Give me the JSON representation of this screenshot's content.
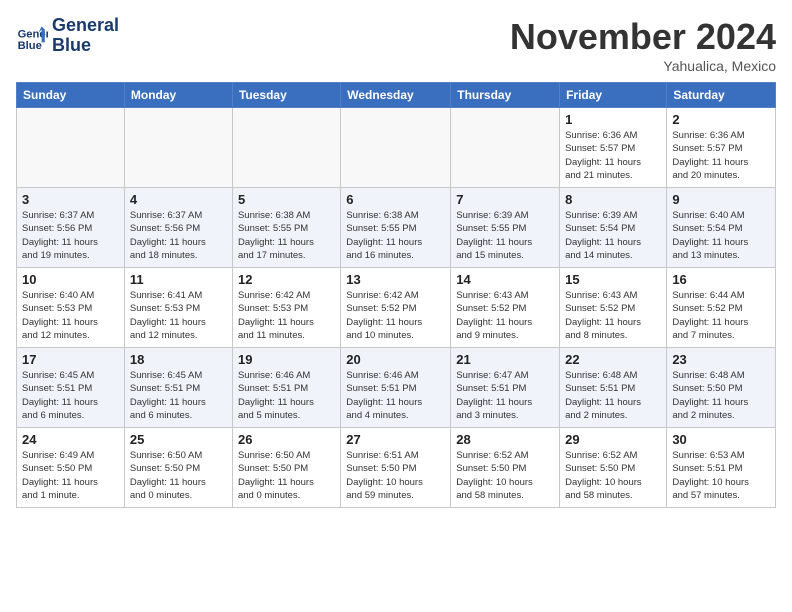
{
  "header": {
    "logo_line1": "General",
    "logo_line2": "Blue",
    "month": "November 2024",
    "location": "Yahualica, Mexico"
  },
  "weekdays": [
    "Sunday",
    "Monday",
    "Tuesday",
    "Wednesday",
    "Thursday",
    "Friday",
    "Saturday"
  ],
  "weeks": [
    [
      {
        "day": "",
        "info": ""
      },
      {
        "day": "",
        "info": ""
      },
      {
        "day": "",
        "info": ""
      },
      {
        "day": "",
        "info": ""
      },
      {
        "day": "",
        "info": ""
      },
      {
        "day": "1",
        "info": "Sunrise: 6:36 AM\nSunset: 5:57 PM\nDaylight: 11 hours\nand 21 minutes."
      },
      {
        "day": "2",
        "info": "Sunrise: 6:36 AM\nSunset: 5:57 PM\nDaylight: 11 hours\nand 20 minutes."
      }
    ],
    [
      {
        "day": "3",
        "info": "Sunrise: 6:37 AM\nSunset: 5:56 PM\nDaylight: 11 hours\nand 19 minutes."
      },
      {
        "day": "4",
        "info": "Sunrise: 6:37 AM\nSunset: 5:56 PM\nDaylight: 11 hours\nand 18 minutes."
      },
      {
        "day": "5",
        "info": "Sunrise: 6:38 AM\nSunset: 5:55 PM\nDaylight: 11 hours\nand 17 minutes."
      },
      {
        "day": "6",
        "info": "Sunrise: 6:38 AM\nSunset: 5:55 PM\nDaylight: 11 hours\nand 16 minutes."
      },
      {
        "day": "7",
        "info": "Sunrise: 6:39 AM\nSunset: 5:55 PM\nDaylight: 11 hours\nand 15 minutes."
      },
      {
        "day": "8",
        "info": "Sunrise: 6:39 AM\nSunset: 5:54 PM\nDaylight: 11 hours\nand 14 minutes."
      },
      {
        "day": "9",
        "info": "Sunrise: 6:40 AM\nSunset: 5:54 PM\nDaylight: 11 hours\nand 13 minutes."
      }
    ],
    [
      {
        "day": "10",
        "info": "Sunrise: 6:40 AM\nSunset: 5:53 PM\nDaylight: 11 hours\nand 12 minutes."
      },
      {
        "day": "11",
        "info": "Sunrise: 6:41 AM\nSunset: 5:53 PM\nDaylight: 11 hours\nand 12 minutes."
      },
      {
        "day": "12",
        "info": "Sunrise: 6:42 AM\nSunset: 5:53 PM\nDaylight: 11 hours\nand 11 minutes."
      },
      {
        "day": "13",
        "info": "Sunrise: 6:42 AM\nSunset: 5:52 PM\nDaylight: 11 hours\nand 10 minutes."
      },
      {
        "day": "14",
        "info": "Sunrise: 6:43 AM\nSunset: 5:52 PM\nDaylight: 11 hours\nand 9 minutes."
      },
      {
        "day": "15",
        "info": "Sunrise: 6:43 AM\nSunset: 5:52 PM\nDaylight: 11 hours\nand 8 minutes."
      },
      {
        "day": "16",
        "info": "Sunrise: 6:44 AM\nSunset: 5:52 PM\nDaylight: 11 hours\nand 7 minutes."
      }
    ],
    [
      {
        "day": "17",
        "info": "Sunrise: 6:45 AM\nSunset: 5:51 PM\nDaylight: 11 hours\nand 6 minutes."
      },
      {
        "day": "18",
        "info": "Sunrise: 6:45 AM\nSunset: 5:51 PM\nDaylight: 11 hours\nand 6 minutes."
      },
      {
        "day": "19",
        "info": "Sunrise: 6:46 AM\nSunset: 5:51 PM\nDaylight: 11 hours\nand 5 minutes."
      },
      {
        "day": "20",
        "info": "Sunrise: 6:46 AM\nSunset: 5:51 PM\nDaylight: 11 hours\nand 4 minutes."
      },
      {
        "day": "21",
        "info": "Sunrise: 6:47 AM\nSunset: 5:51 PM\nDaylight: 11 hours\nand 3 minutes."
      },
      {
        "day": "22",
        "info": "Sunrise: 6:48 AM\nSunset: 5:51 PM\nDaylight: 11 hours\nand 2 minutes."
      },
      {
        "day": "23",
        "info": "Sunrise: 6:48 AM\nSunset: 5:50 PM\nDaylight: 11 hours\nand 2 minutes."
      }
    ],
    [
      {
        "day": "24",
        "info": "Sunrise: 6:49 AM\nSunset: 5:50 PM\nDaylight: 11 hours\nand 1 minute."
      },
      {
        "day": "25",
        "info": "Sunrise: 6:50 AM\nSunset: 5:50 PM\nDaylight: 11 hours\nand 0 minutes."
      },
      {
        "day": "26",
        "info": "Sunrise: 6:50 AM\nSunset: 5:50 PM\nDaylight: 11 hours\nand 0 minutes."
      },
      {
        "day": "27",
        "info": "Sunrise: 6:51 AM\nSunset: 5:50 PM\nDaylight: 10 hours\nand 59 minutes."
      },
      {
        "day": "28",
        "info": "Sunrise: 6:52 AM\nSunset: 5:50 PM\nDaylight: 10 hours\nand 58 minutes."
      },
      {
        "day": "29",
        "info": "Sunrise: 6:52 AM\nSunset: 5:50 PM\nDaylight: 10 hours\nand 58 minutes."
      },
      {
        "day": "30",
        "info": "Sunrise: 6:53 AM\nSunset: 5:51 PM\nDaylight: 10 hours\nand 57 minutes."
      }
    ]
  ]
}
